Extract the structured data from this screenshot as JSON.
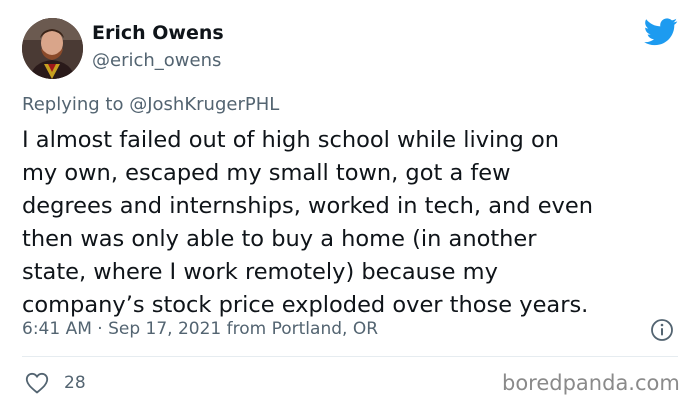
{
  "author": {
    "display_name": "Erich Owens",
    "handle": "@erich_owens"
  },
  "reply": {
    "prefix": "Replying to",
    "mention": "@JoshKrugerPHL"
  },
  "tweet": {
    "lines": [
      "I almost failed out of high school while living on",
      "my own, escaped my small town, got a few",
      "degrees and internships, worked in tech, and even",
      "then was only able to buy a home (in another",
      "state, where I work remotely) because my",
      "company’s stock price exploded over those years."
    ],
    "timestamp": "6:41 AM · Sep 17, 2021 from Portland, OR"
  },
  "engagement": {
    "likes": "28"
  },
  "watermark": "boredpanda.com",
  "icons": {
    "brand": "twitter-bird-icon",
    "info": "info-icon",
    "like": "heart-icon"
  },
  "colors": {
    "twitter_blue": "#1d9bf0",
    "text": "#0f1419",
    "secondary": "#536471"
  }
}
